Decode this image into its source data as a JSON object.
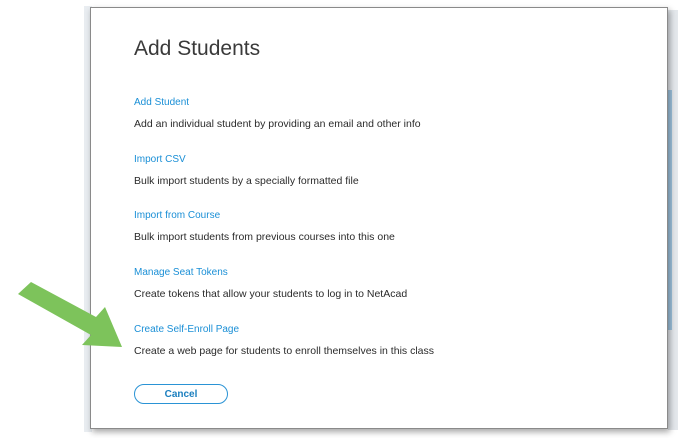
{
  "modal": {
    "title": "Add Students",
    "options": [
      {
        "label": "Add Student",
        "description": "Add an individual student by providing an email and other info"
      },
      {
        "label": "Import CSV",
        "description": "Bulk import students by a specially formatted file"
      },
      {
        "label": "Import from Course",
        "description": "Bulk import students from previous courses into this one"
      },
      {
        "label": "Manage Seat Tokens",
        "description": "Create tokens that allow your students to log in to NetAcad"
      },
      {
        "label": "Create Self-Enroll Page",
        "description": "Create a web page for students to enroll themselves in this class"
      }
    ],
    "cancel_label": "Cancel"
  },
  "annotation": {
    "arrow_color": "#7dc35b",
    "arrow_icon": "arrow-right-icon"
  },
  "colors": {
    "link": "#1a8fd6",
    "button_border": "#2a93d5",
    "title_text": "#3a3a3a"
  }
}
